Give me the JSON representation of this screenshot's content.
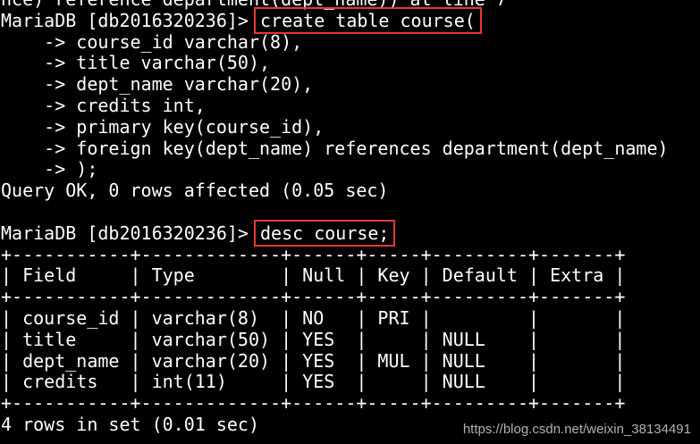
{
  "terminal": {
    "background": "#000000",
    "foreground": "#ffffff",
    "highlight_color": "#e53935",
    "lines": [
      {
        "segments": [
          {
            "text": "nce) reference department(dept_name)) at line 7"
          }
        ]
      },
      {
        "segments": [
          {
            "text": "MariaDB [db2016320236]> "
          },
          {
            "text": "create table course(",
            "highlight": true
          }
        ]
      },
      {
        "segments": [
          {
            "text": "    -> course_id varchar(8),"
          }
        ]
      },
      {
        "segments": [
          {
            "text": "    -> title varchar(50),"
          }
        ]
      },
      {
        "segments": [
          {
            "text": "    -> dept_name varchar(20),"
          }
        ]
      },
      {
        "segments": [
          {
            "text": "    -> credits int,"
          }
        ]
      },
      {
        "segments": [
          {
            "text": "    -> primary key(course_id),"
          }
        ]
      },
      {
        "segments": [
          {
            "text": "    -> foreign key(dept_name) references department(dept_name)"
          }
        ]
      },
      {
        "segments": [
          {
            "text": "    -> );"
          }
        ]
      },
      {
        "segments": [
          {
            "text": "Query OK, 0 rows affected (0.05 sec)"
          }
        ]
      },
      {
        "segments": [
          {
            "text": ""
          }
        ]
      },
      {
        "segments": [
          {
            "text": "MariaDB [db2016320236]> "
          },
          {
            "text": "desc course;",
            "highlight": true
          }
        ]
      },
      {
        "segments": [
          {
            "text": "+-----------+-------------+------+-----+---------+-------+"
          }
        ]
      },
      {
        "segments": [
          {
            "text": "| Field     | Type        | Null | Key | Default | Extra |"
          }
        ]
      },
      {
        "segments": [
          {
            "text": "+-----------+-------------+------+-----+---------+-------+"
          }
        ]
      },
      {
        "segments": [
          {
            "text": "| course_id | varchar(8)  | NO   | PRI |         |       |"
          }
        ]
      },
      {
        "segments": [
          {
            "text": "| title     | varchar(50) | YES  |     | NULL    |       |"
          }
        ]
      },
      {
        "segments": [
          {
            "text": "| dept_name | varchar(20) | YES  | MUL | NULL    |       |"
          }
        ]
      },
      {
        "segments": [
          {
            "text": "| credits   | int(11)     | YES  |     | NULL    |       |"
          }
        ]
      },
      {
        "segments": [
          {
            "text": "+-----------+-------------+------+-----+---------+-------+"
          }
        ]
      },
      {
        "segments": [
          {
            "text": "4 rows in set (0.01 sec)"
          }
        ]
      }
    ]
  },
  "watermark": "https://blog.csdn.net/weixin_38134491"
}
